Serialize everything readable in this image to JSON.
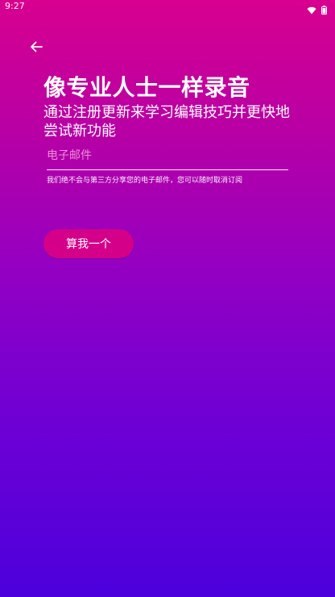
{
  "status_bar": {
    "time": "9:27",
    "icons": [
      "wifi-icon",
      "battery-icon"
    ]
  },
  "nav": {
    "back_icon": "arrow-left-icon"
  },
  "content": {
    "title": "像专业人士一样录音",
    "subtitle": "通过注册更新来学习编辑技巧并更快地尝试新功能",
    "email_placeholder": "电子邮件",
    "notice": "我们绝不会与第三方分享您的电子邮件，您可以随时取消订阅",
    "cta_label": "算我一个"
  },
  "colors": {
    "gradient_top": "#d8008f",
    "gradient_bottom": "#4c00dc",
    "button": "#d4008a",
    "text": "#ffffff"
  }
}
